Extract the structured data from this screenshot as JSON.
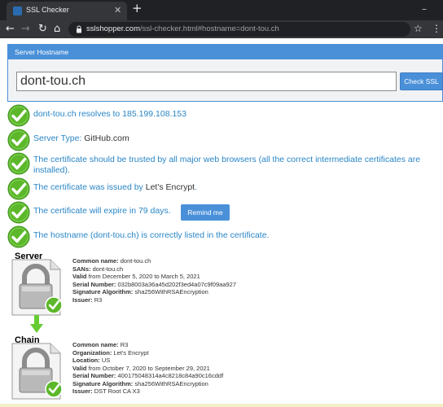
{
  "browser": {
    "tab_title": "SSL Checker",
    "url_host": "sslshopper.com",
    "url_path": "/ssl-checker.html#hostname=dont-tou.ch",
    "icons": [
      "back-icon",
      "forward-icon",
      "reload-icon",
      "home-icon",
      "lock-icon",
      "star-icon",
      "menu-icon",
      "close-icon",
      "plus-icon",
      "minimize-icon"
    ]
  },
  "form": {
    "header": "Server Hostname",
    "hostname_value": "dont-tou.ch",
    "button_label": "Check SSL"
  },
  "results": {
    "resolves": {
      "prefix": "dont-tou.ch resolves to ",
      "value": "185.199.108.153"
    },
    "server_type": {
      "prefix": "Server Type: ",
      "value": "GitHub.com"
    },
    "trusted": "The certificate should be trusted by all major web browsers (all the correct intermediate certificates are installed).",
    "issued_by": {
      "prefix": "The certificate was issued by ",
      "value": "Let's Encrypt",
      "suffix": "."
    },
    "expires": {
      "text": "The certificate will expire in 79 days.",
      "button_label": "Remind me"
    },
    "hostname_listed": "The hostname (dont-tou.ch) is correctly listed in the certificate."
  },
  "certificates": [
    {
      "label": "Server",
      "rows": [
        {
          "label": "Common name:",
          "value": " dont-tou.ch"
        },
        {
          "label": "SANs:",
          "value": " dont-tou.ch"
        },
        {
          "label": "Valid",
          "value": " from December 5, 2020 to March 5, 2021"
        },
        {
          "label": "Serial Number:",
          "value": " 032b8003a36a45d202f3ed4a07c9f09aa927"
        },
        {
          "label": "Signature Algorithm:",
          "value": " sha256WithRSAEncryption"
        },
        {
          "label": "Issuer:",
          "value": " R3"
        }
      ]
    },
    {
      "label": "Chain",
      "rows": [
        {
          "label": "Common name:",
          "value": " R3"
        },
        {
          "label": "Organization:",
          "value": " Let's Encrypt"
        },
        {
          "label": "Location:",
          "value": " US"
        },
        {
          "label": "Valid",
          "value": " from October 7, 2020 to September 29, 2021"
        },
        {
          "label": "Serial Number:",
          "value": " 400175048314a4c8218c84a90c16cddf"
        },
        {
          "label": "Signature Algorithm:",
          "value": " sha256WithRSAEncryption"
        },
        {
          "label": "Issuer:",
          "value": " DST Root CA X3"
        }
      ]
    }
  ],
  "colors": {
    "accent": "#4a90d9",
    "link_text": "#2a86c7",
    "check_green": "#5cb82a",
    "chrome_dark": "#202124"
  }
}
